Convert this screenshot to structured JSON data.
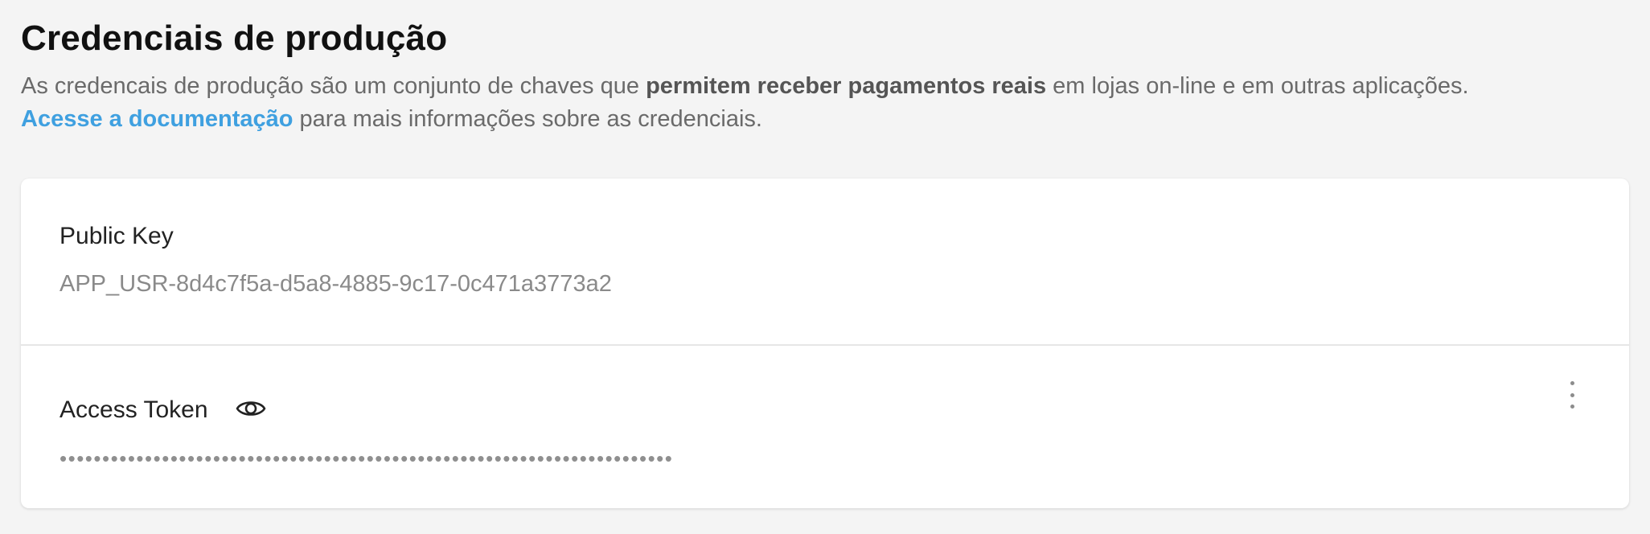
{
  "header": {
    "title": "Credenciais de produção",
    "description": {
      "part1": "As credencais de produção são um conjunto de chaves que ",
      "bold": "permitem receber pagamentos reais",
      "part2": " em lojas on-line e em outras aplicações.",
      "link": "Acesse a documentação",
      "part3": " para mais informações sobre as credenciais."
    }
  },
  "credentials": {
    "public_key": {
      "label": "Public Key",
      "value": "APP_USR-8d4c7f5a-d5a8-4885-9c17-0c471a3773a2"
    },
    "access_token": {
      "label": "Access Token",
      "value": "••••••••••••••••••••••••••••••••••••••••••••••••••••••••••••••••••••••••",
      "reveal_icon": "eye-icon",
      "menu_icon": "more-vertical-icon"
    }
  },
  "colors": {
    "link": "#3fa0e0",
    "background": "#f4f4f4",
    "card": "#ffffff"
  }
}
